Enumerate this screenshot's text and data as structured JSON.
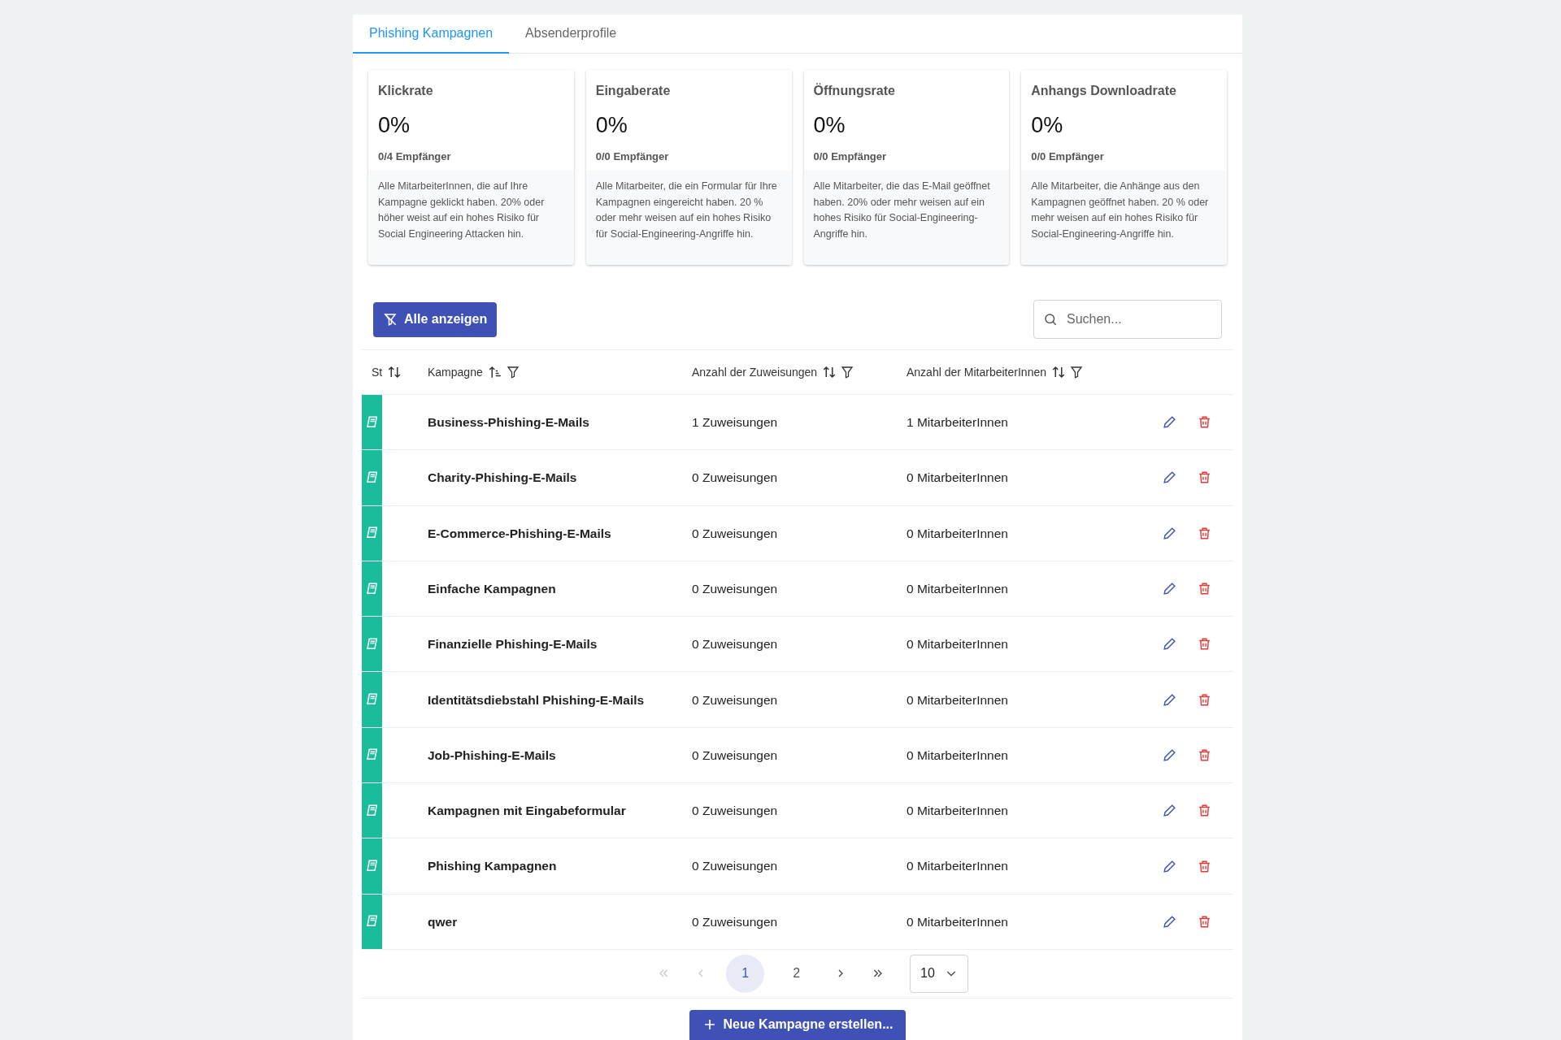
{
  "tabs": [
    {
      "label": "Phishing Kampagnen",
      "selected": true
    },
    {
      "label": "Absenderprofile",
      "selected": false
    }
  ],
  "cards": [
    {
      "title": "Klickrate",
      "value": "0%",
      "recipients": "0/4 Empfänger",
      "description": "Alle MitarbeiterInnen, die auf Ihre Kampagne geklickt haben. 20% oder höher weist auf ein hohes Risiko für Social Engineering Attacken hin."
    },
    {
      "title": "Eingaberate",
      "value": "0%",
      "recipients": "0/0 Empfänger",
      "description": "Alle Mitarbeiter, die ein Formular für Ihre Kampagnen eingereicht haben. 20 % oder mehr weisen auf ein hohes Risiko für Social-Engineering-Angriffe hin."
    },
    {
      "title": "Öffnungsrate",
      "value": "0%",
      "recipients": "0/0 Empfänger",
      "description": "Alle Mitarbeiter, die das E-Mail geöffnet haben. 20% oder mehr weisen auf ein hohes Risiko für Social-Engineering-Angriffe hin."
    },
    {
      "title": "Anhangs Downloadrate",
      "value": "0%",
      "recipients": "0/0 Empfänger",
      "description": "Alle Mitarbeiter, die Anhänge aus den Kampagnen geöffnet haben. 20 % oder mehr weisen auf ein hohes Risiko für Social-Engineering-Angriffe hin."
    }
  ],
  "toolbar": {
    "filter_button": "Alle anzeigen",
    "search": {
      "placeholder": "Suchen..."
    }
  },
  "table": {
    "columns": [
      {
        "label": "St",
        "sorted": false,
        "filterable": false
      },
      {
        "label": "Kampagne",
        "sorted": true,
        "filterable": true
      },
      {
        "label": "Anzahl der Zuweisungen",
        "sorted": false,
        "filterable": true
      },
      {
        "label": "Anzahl der MitarbeiterInnen",
        "sorted": false,
        "filterable": true
      }
    ],
    "rows": [
      {
        "name": "Business-Phishing-E-Mails",
        "assignments": "1 Zuweisungen",
        "employees": "1 MitarbeiterInnen"
      },
      {
        "name": "Charity-Phishing-E-Mails",
        "assignments": "0 Zuweisungen",
        "employees": "0 MitarbeiterInnen"
      },
      {
        "name": "E-Commerce-Phishing-E-Mails",
        "assignments": "0 Zuweisungen",
        "employees": "0 MitarbeiterInnen"
      },
      {
        "name": "Einfache Kampagnen",
        "assignments": "0 Zuweisungen",
        "employees": "0 MitarbeiterInnen"
      },
      {
        "name": "Finanzielle Phishing-E-Mails",
        "assignments": "0 Zuweisungen",
        "employees": "0 MitarbeiterInnen"
      },
      {
        "name": "Identitätsdiebstahl Phishing-E-Mails",
        "assignments": "0 Zuweisungen",
        "employees": "0 MitarbeiterInnen"
      },
      {
        "name": "Job-Phishing-E-Mails",
        "assignments": "0 Zuweisungen",
        "employees": "0 MitarbeiterInnen"
      },
      {
        "name": "Kampagnen mit Eingabeformular",
        "assignments": "0 Zuweisungen",
        "employees": "0 MitarbeiterInnen"
      },
      {
        "name": "Phishing Kampagnen",
        "assignments": "0 Zuweisungen",
        "employees": "0 MitarbeiterInnen"
      },
      {
        "name": "qwer",
        "assignments": "0 Zuweisungen",
        "employees": "0 MitarbeiterInnen"
      }
    ]
  },
  "pagination": {
    "first_disabled": true,
    "prev_disabled": true,
    "next_disabled": false,
    "last_disabled": false,
    "pages": [
      {
        "label": "1",
        "selected": true
      },
      {
        "label": "2",
        "selected": false
      }
    ],
    "page_size": "10"
  },
  "create_button": "Neue Kampagne erstellen..."
}
